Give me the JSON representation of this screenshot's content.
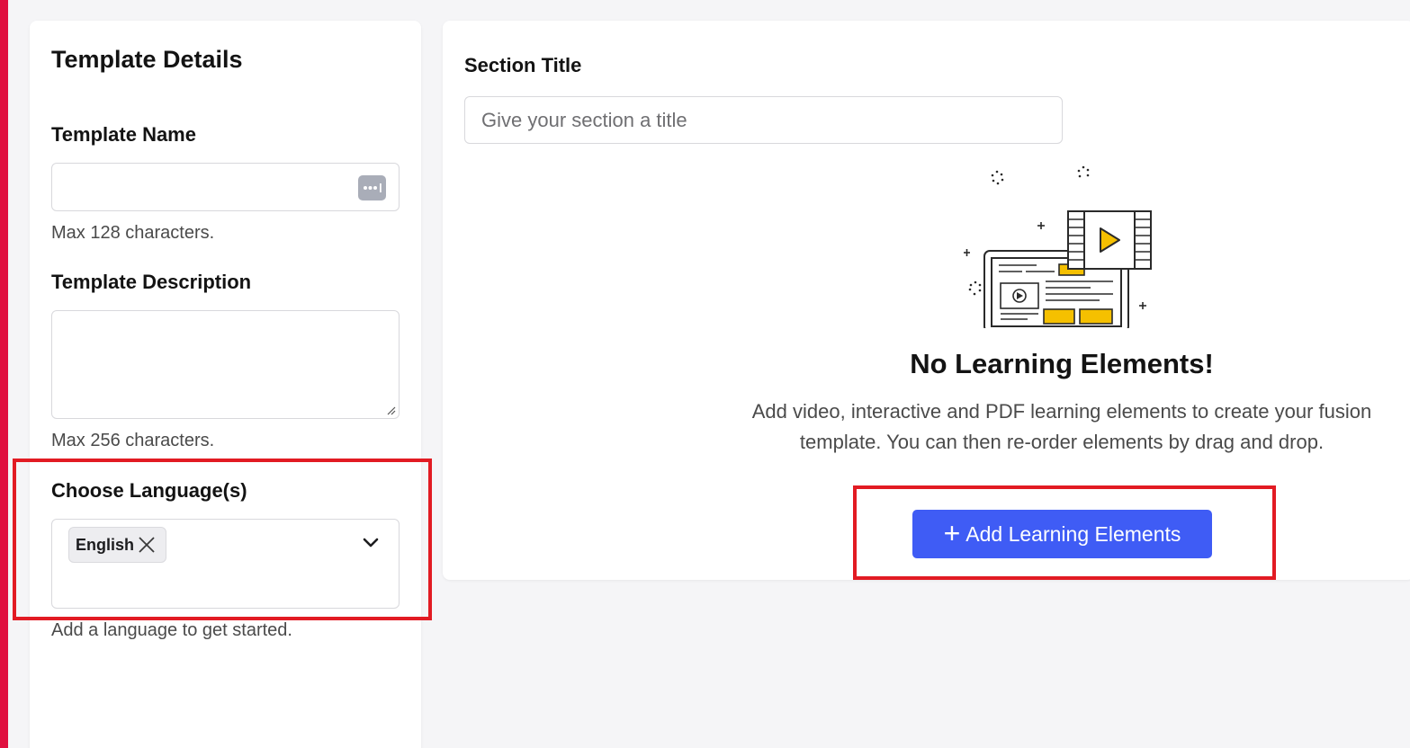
{
  "template_details": {
    "title": "Template Details",
    "name_label": "Template Name",
    "name_value": "",
    "name_hint": "Max 128 characters.",
    "description_label": "Template Description",
    "description_value": "",
    "description_hint": "Max 256 characters.",
    "language_label": "Choose Language(s)",
    "selected_languages": [
      "English"
    ],
    "language_hint": "Add a language to get started."
  },
  "section": {
    "title_label": "Section Title",
    "title_placeholder": "Give your section a title",
    "empty_title": "No Learning Elements!",
    "empty_description": "Add video, interactive and PDF learning elements to create your fusion template. You can then re-order elements by drag and drop.",
    "add_button_label": "Add Learning Elements"
  },
  "icons": {
    "password_manager": "password-dots-icon",
    "remove_chip": "close-icon",
    "dropdown": "chevron-down-icon",
    "add": "plus-icon",
    "illustration": "laptop-video-illustration"
  },
  "colors": {
    "accent_strip": "#e0103f",
    "primary_button": "#3f5cf5",
    "highlight_box": "#e21b23",
    "illustration_accent": "#f5c000"
  }
}
